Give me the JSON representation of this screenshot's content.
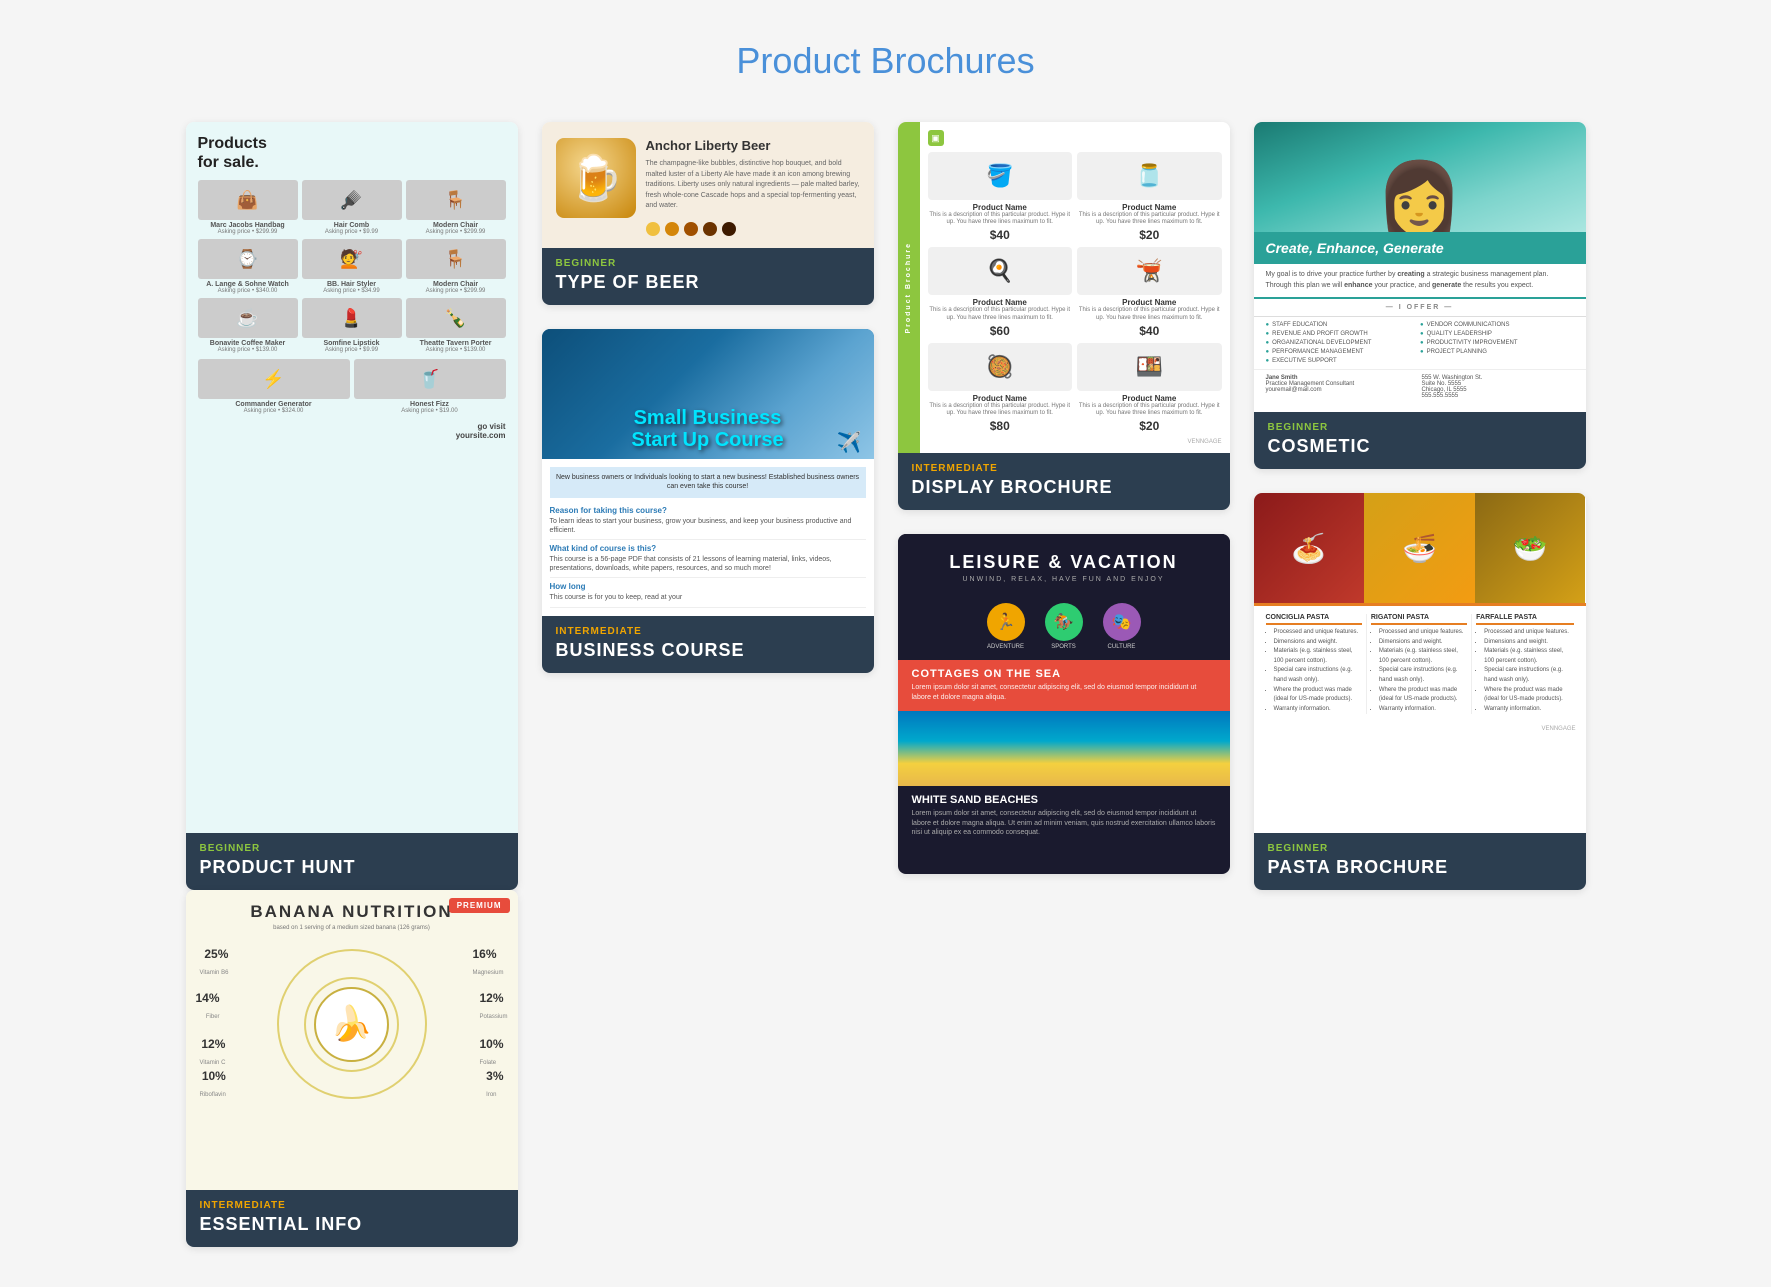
{
  "page": {
    "title": "Product Brochures"
  },
  "cards": [
    {
      "id": "product-hunt",
      "level": "BEGINNER",
      "levelClass": "beginner",
      "title": "PRODUCT HUNT",
      "preview": {
        "heading1": "Products",
        "heading2": "for sale.",
        "items": [
          {
            "name": "Marc Jacobs Handbag",
            "price": "Asking price • $299.99",
            "emoji": "👜"
          },
          {
            "name": "Hair Comb",
            "price": "Asking price • $9.99",
            "emoji": "🪮"
          },
          {
            "name": "A. Lange & Sohne Watch",
            "price": "Asking price • $340.00",
            "emoji": "⌚"
          },
          {
            "name": "BB. Hair Styler",
            "price": "Asking price • $34.99",
            "emoji": "💇"
          },
          {
            "name": "Modern Chair",
            "price": "Asking price • $299.99",
            "emoji": "🪑"
          },
          {
            "name": "Bonavite Coffee Maker",
            "price": "Asking price • $139.00",
            "emoji": "☕"
          },
          {
            "name": "Somfine Lipstick",
            "price": "Asking price • $9.99",
            "emoji": "💄"
          },
          {
            "name": "Theatte Tavern Porter",
            "price": "Asking price • $139.00",
            "emoji": "🍾"
          },
          {
            "name": "Commander Generator",
            "price": "Asking price • $324.00",
            "emoji": "⚡"
          },
          {
            "name": "Honest Fizz",
            "price": "Asking price • $19.00",
            "emoji": "🥤"
          }
        ],
        "visit_text": "go visit",
        "visit_url": "yoursite.com"
      }
    },
    {
      "id": "beer",
      "level": "BEGINNER",
      "levelClass": "beginner",
      "title": "TYPE OF BEER",
      "preview": {
        "name": "Anchor Liberty Beer",
        "description": "The champagne-like bubbles, distinctive hop bouquet, and bold malted luster of a Liberty Ale have made it an icon among brewing traditions. Liberty uses only natural ingredients — pale malted barley, fresh whole-cone Cascade hops and a special top-fermenting yeast, and water.",
        "colors": [
          "#f0c040",
          "#d4860a",
          "#a05000",
          "#6b3300",
          "#3d1a00"
        ]
      }
    },
    {
      "id": "display-brochure",
      "level": "INTERMEDIATE",
      "levelClass": "intermediate",
      "title": "DISPLAY BROCHURE",
      "preview": {
        "sidebar_text": "Product Brochure",
        "venngage": "VENNGAGE",
        "items": [
          {
            "name": "Product Name",
            "price": "$40",
            "emoji": "🪣"
          },
          {
            "name": "Product Name",
            "price": "$20",
            "emoji": "🫙"
          },
          {
            "name": "Product Name",
            "price": "$60",
            "emoji": "🍳"
          },
          {
            "name": "Product Name",
            "price": "$40",
            "emoji": "🫕"
          },
          {
            "name": "Product Name",
            "price": "$80",
            "emoji": "🥘"
          },
          {
            "name": "Product Name",
            "price": "$20",
            "emoji": "🍱"
          }
        ]
      }
    },
    {
      "id": "cosmetic",
      "level": "BEGINNER",
      "levelClass": "beginner",
      "title": "COSMETIC",
      "preview": {
        "tagline": "Create, Enhance, Generate",
        "description": "My goal is to drive your practice further by creating a strategic business management plan. Through this plan we will enhance your practice, and generate the results you expect.",
        "offer_label": "I OFFER",
        "services": [
          "STAFF EDUCATION",
          "VENDOR COMMUNICATIONS",
          "REVENUE AND PROFIT GROWTH",
          "QUALITY LEADERSHIP",
          "ORGANIZATIONAL DEVELOPMENT",
          "PRODUCTIVITY IMPROVEMENT",
          "PERFORMANCE MANAGEMENT",
          "PROJECT PLANNING",
          "EXECUTIVE SUPPORT"
        ],
        "contact": {
          "name": "Jane Smith",
          "title": "Practice Management Consultant",
          "email": "youremail@mail.com",
          "address": "555 W. Washington St. Suite No. 5555 Chicago, IL 5555",
          "phone": "555.555.5555"
        }
      }
    },
    {
      "id": "banana-nutrition",
      "level": "INTERMEDIATE",
      "levelClass": "intermediate",
      "title": "ESSENTIAL INFO",
      "preview": {
        "badge": "PREMIUM",
        "title": "BANANA NUTRITION",
        "subtitle": "based on 1 serving of a medium sized banana (126 grams)",
        "stats": [
          {
            "pct": "25%",
            "label": "Vitamin B6",
            "pos": "top-left"
          },
          {
            "pct": "16%",
            "label": "Magnesium",
            "pos": "top-right"
          },
          {
            "pct": "14%",
            "label": "Fiber",
            "pos": "mid-left"
          },
          {
            "pct": "12%",
            "label": "Potassium",
            "pos": "mid-right"
          },
          {
            "pct": "12%",
            "label": "Vitamin C",
            "pos": "low-left"
          },
          {
            "pct": "10%",
            "label": "Folate",
            "pos": "low-right"
          },
          {
            "pct": "10%",
            "label": "Riboflavin",
            "pos": "bot-left"
          },
          {
            "pct": "3%",
            "label": "Iron",
            "pos": "bot-right"
          }
        ]
      }
    },
    {
      "id": "business-course",
      "level": "INTERMEDIATE",
      "levelClass": "intermediate",
      "title": "BUSINESS COURSE",
      "preview": {
        "title_line1": "Small Business",
        "title_line2": "Start Up Course",
        "intro": "New business owners or Individuals looking to start a new business! Established business owners can even take this course!",
        "qa": [
          {
            "q": "Reason for taking this course?",
            "a": "To learn ideas to start your business, grow your business, and keep your business productive and efficient."
          },
          {
            "q": "What kind of course is this?",
            "a": "This course is a 56-page PDF that consists of 21 lessons of learning material, links, videos, presentations, downloads, white papers, resources, and so much more!"
          },
          {
            "q": "How long",
            "a": "This course is for you to keep, read at your"
          }
        ]
      }
    },
    {
      "id": "leisure-vacation",
      "level": "",
      "levelClass": "",
      "title": "",
      "preview": {
        "title": "LEISURE & VACATION",
        "subtitle": "UNWIND, RELAX, HAVE FUN AND ENJOY",
        "icons": [
          {
            "emoji": "🏃",
            "color": "#f0a500",
            "label": "ADVENTURE"
          },
          {
            "emoji": "🏇",
            "color": "#2ecc71",
            "label": "SPORTS"
          },
          {
            "emoji": "🎭",
            "color": "#9b59b6",
            "label": "CULTURE"
          }
        ],
        "section1_title": "COTTAGES ON THE SEA",
        "section1_text": "Lorem ipsum dolor sit amet, consectetur adipiscing elit, sed do eiusmod tempor incididunt ut labore et dolore magna aliqua.",
        "section2_title": "WHITE SAND BEACHES",
        "section2_text": "Lorem ipsum dolor sit amet, consectetur adipiscing elit, sed do eiusmod tempor incididunt ut labore et dolore magna aliqua. Ut enim ad minim veniam, quis nostrud exercitation ullamco laboris nisi ut aliquip ex ea commodo consequat."
      }
    },
    {
      "id": "pasta-brochure",
      "level": "BEGINNER",
      "levelClass": "beginner",
      "title": "PASTA BROCHURE",
      "preview": {
        "columns": [
          {
            "title": "CONCIGLIA PASTA",
            "items": [
              "Processed and unique features.",
              "Dimensions and weight.",
              "Materials (e.g. stainless steel, 100 percent cotton).",
              "Special care instructions (e.g. hand wash only).",
              "Where the product was made (ideal for US-made products).",
              "Warranty information."
            ]
          },
          {
            "title": "RIGATONI PASTA",
            "items": [
              "Processed and unique features.",
              "Dimensions and weight.",
              "Materials (e.g. stainless steel, 100 percent cotton).",
              "Special care instructions (e.g. hand wash only).",
              "Where the product was made (ideal for US-made products).",
              "Warranty information."
            ]
          },
          {
            "title": "FARFALLE PASTA",
            "items": [
              "Processed and unique features.",
              "Dimensions and weight.",
              "Materials (e.g. stainless steel, 100 percent cotton).",
              "Special care instructions (e.g. hand wash only).",
              "Where the product was made (ideal for US-made products).",
              "Warranty information."
            ]
          }
        ],
        "venngage": "VENNGAGE"
      }
    }
  ]
}
